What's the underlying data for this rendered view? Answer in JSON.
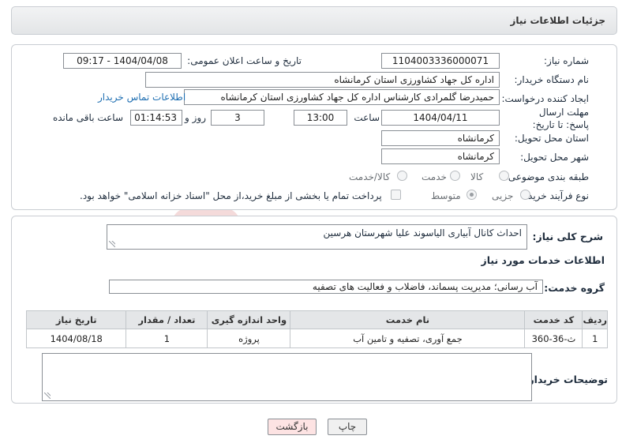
{
  "header": {
    "title": "جزئیات اطلاعات نیاز"
  },
  "labels": {
    "need_number": "شماره نیاز:",
    "announce_datetime": "تاریخ و ساعت اعلان عمومی:",
    "buyer_org": "نام دستگاه خریدار:",
    "requester": "ایجاد کننده درخواست:",
    "contact_link": "اطلاعات تماس خریدار",
    "deadline": "مهلت ارسال پاسخ: تا تاریخ:",
    "time": "ساعت",
    "day_and": "روز و",
    "remaining": "ساعت باقی مانده",
    "province": "استان محل تحویل:",
    "city": "شهر محل تحویل:",
    "category": "طبقه بندی موضوعی:",
    "process": "نوع فرآیند خرید :",
    "description_title": "شرح کلی نیاز:",
    "services_title": "اطلاعات خدمات مورد نیاز",
    "service_group": "گروه خدمت:",
    "buyer_notes": "توضیحات خریدار:"
  },
  "values": {
    "need_number": "1104003336000071",
    "announce_datetime": "1404/04/08 - 09:17",
    "buyer_org": "اداره کل جهاد کشاورزی استان کرمانشاه",
    "requester": "حمیدرضا گلمرادی کارشناس اداره کل جهاد کشاورزی استان کرمانشاه",
    "deadline_date": "1404/04/11",
    "deadline_time": "13:00",
    "days": "3",
    "remaining_time": "01:14:53",
    "province": "کرمانشاه",
    "city": "کرمانشاه",
    "description": "احداث  کانال  آبیاری الیاسوند علیا شهرستان هرسین",
    "service_group": "آب رسانی؛ مدیریت پسماند، فاضلاب و فعالیت های تصفیه",
    "buyer_notes": ""
  },
  "category_options": [
    {
      "label": "کالا",
      "selected": false
    },
    {
      "label": "خدمت",
      "selected": false
    },
    {
      "label": "کالا/خدمت",
      "selected": false
    }
  ],
  "process_options": [
    {
      "label": "جزیی",
      "selected": false
    },
    {
      "label": "متوسط",
      "selected": true
    }
  ],
  "payment_note": "پرداخت تمام یا بخشی از مبلغ خرید،از محل \"اسناد خزانه اسلامی\" خواهد بود.",
  "table": {
    "headers": [
      "ردیف",
      "کد خدمت",
      "نام خدمت",
      "واحد اندازه گیری",
      "تعداد / مقدار",
      "تاریخ نیاز"
    ],
    "rows": [
      [
        "1",
        "ث-36-360",
        "جمع آوری، تصفیه و تامین آب",
        "پروژه",
        "1",
        "1404/08/18"
      ]
    ]
  },
  "buttons": {
    "print": "چاپ",
    "back": "بازگشت"
  },
  "watermark": {
    "text": "AriaTender.net"
  },
  "colors": {
    "link": "#1f6fb2",
    "back_button": "#fde3e3",
    "watermark": "#f3d6d6"
  }
}
